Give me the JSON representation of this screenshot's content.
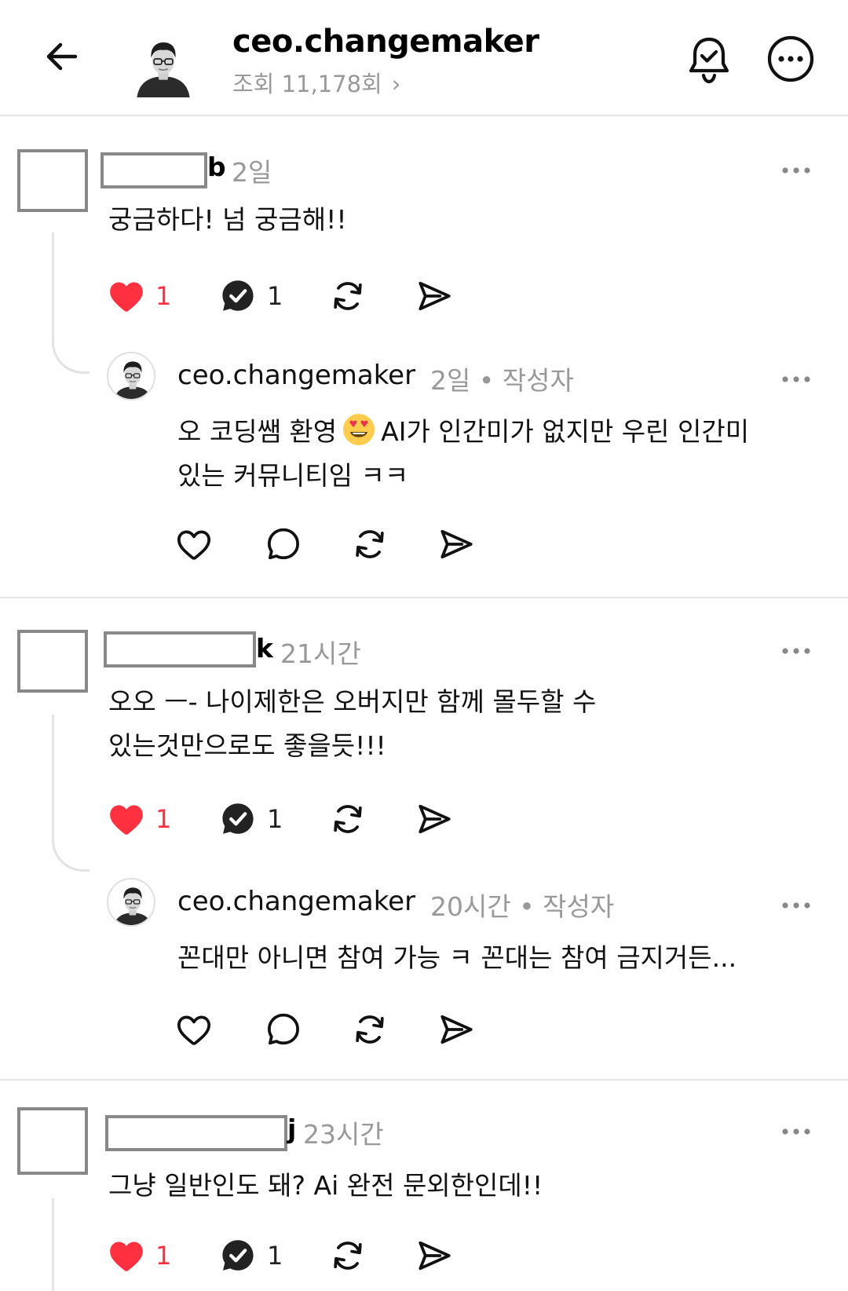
{
  "header": {
    "title": "ceo.changemaker",
    "views": "조회 11,178회",
    "chevron": "›"
  },
  "comments": [
    {
      "name_tail": "b",
      "time": "2일",
      "text_lines": [
        "궁금하다! 넘 궁금해!!"
      ],
      "likes": "1",
      "replies": "1",
      "reply": {
        "author": "ceo.changemaker",
        "meta": "2일 • 작성자",
        "text_line1_a": "오 코딩쌤 환영",
        "text_line1_b": "AI가 인간미가 없지만 우린 인간미",
        "text_line2": "있는 커뮤니티임 ㅋㅋ",
        "emoji": "smiling-face-with-heart-eyes"
      }
    },
    {
      "name_tail": "k",
      "time": "21시간",
      "text_lines": [
        "오오 ㅡ- 나이제한은 오버지만 함께 몰두할 수",
        "있는것만으로도 좋을듯!!!"
      ],
      "likes": "1",
      "replies": "1",
      "reply": {
        "author": "ceo.changemaker",
        "meta": "20시간 • 작성자",
        "text_line1": "꼰대만 아니면 참여 가능 ㅋ 꼰대는 참여 금지거든..."
      }
    },
    {
      "name_tail": "j",
      "time": "23시간",
      "text_lines": [
        "그냥 일반인도 돼? Ai 완전 문외한인데!!"
      ],
      "likes": "1",
      "replies": "1"
    }
  ],
  "colors": {
    "like_red": "#ff3040",
    "muted": "#999999",
    "divider": "#e6e6e6"
  }
}
